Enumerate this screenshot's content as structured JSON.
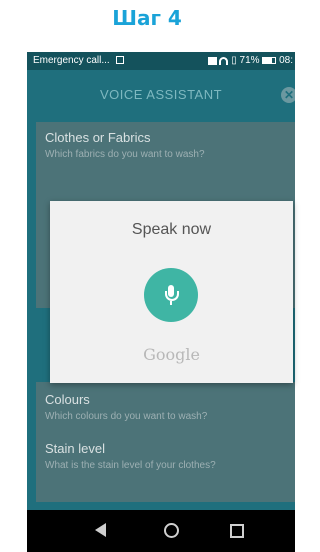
{
  "page": {
    "step_label": "Шаг 4"
  },
  "status_bar": {
    "notification": "Emergency call...",
    "battery": "71%",
    "time": "08:"
  },
  "app_bar": {
    "title": "VOICE ASSISTANT"
  },
  "card_clothes": {
    "title": "Clothes or Fabrics",
    "question": "Which fabrics do you want to wash?"
  },
  "dialog": {
    "title": "Speak now",
    "brand": "Google"
  },
  "card_colours": {
    "title": "Colours",
    "question": "Which colours do you want to wash?"
  },
  "card_stain": {
    "title": "Stain level",
    "question": "What is the stain level of your clothes?"
  },
  "colors": {
    "step_accent": "#1aa3d8",
    "app_background": "#1f6f7d",
    "mic_button": "#3fb5a4"
  }
}
